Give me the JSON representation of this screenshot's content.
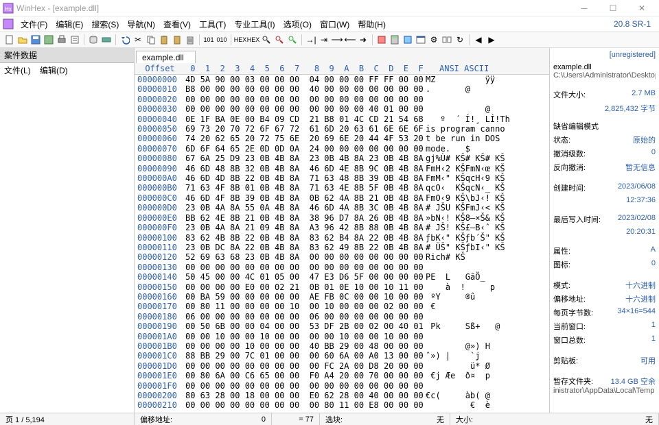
{
  "title": "WinHex - [example.dll]",
  "version": "20.8 SR-1",
  "menubar": [
    "文件(F)",
    "编辑(E)",
    "搜索(S)",
    "导航(N)",
    "查看(V)",
    "工具(T)",
    "专业工具(I)",
    "选项(O)",
    "窗口(W)",
    "帮助(H)"
  ],
  "left_panel": {
    "header": "案件数据",
    "menu": [
      "文件(L)",
      "编辑(D)"
    ]
  },
  "tab": "example.dll",
  "hex_head": {
    "offset": "Offset",
    "cols": " 0  1  2  3  4  5  6  7   8  9  A  B  C  D  E  F",
    "ascii": "ANSI ASCII"
  },
  "rows": [
    {
      "addr": "00000000",
      "b": "4D 5A 90 00 03 00 00 00  04 00 00 00 FF FF 00 00",
      "a": "MZ          ÿÿ"
    },
    {
      "addr": "00000010",
      "b": "B8 00 00 00 00 00 00 00  40 00 00 00 00 00 00 00",
      "a": ".       @"
    },
    {
      "addr": "00000020",
      "b": "00 00 00 00 00 00 00 00  00 00 00 00 00 00 00 00",
      "a": ""
    },
    {
      "addr": "00000030",
      "b": "00 00 00 00 00 00 00 00  00 00 00 00 40 01 00 00",
      "a": "            @"
    },
    {
      "addr": "00000040",
      "b": "0E 1F BA 0E 00 B4 09 CD  21 B8 01 4C CD 21 54 68",
      "a": "   º  ´ Í!¸ LÍ!Th"
    },
    {
      "addr": "00000050",
      "b": "69 73 20 70 72 6F 67 72  61 6D 20 63 61 6E 6E 6F",
      "a": "is program canno"
    },
    {
      "addr": "00000060",
      "b": "74 20 62 65 20 72 75 6E  20 69 6E 20 44 4F 53 20",
      "a": "t be run in DOS "
    },
    {
      "addr": "00000070",
      "b": "6D 6F 64 65 2E 0D 0D 0A  24 00 00 00 00 00 00 00",
      "a": "mode.   $"
    },
    {
      "addr": "00000080",
      "b": "67 6A 25 D9 23 0B 4B 8A  23 0B 4B 8A 23 0B 4B 8A",
      "a": "gj%Ù# KŠ# KŠ# KŠ"
    },
    {
      "addr": "00000090",
      "b": "46 6D 48 8B 32 0B 4B 8A  46 6D 4E 8B 9C 0B 4B 8A",
      "a": "FmH‹2 KŠFmN‹œ KŠ"
    },
    {
      "addr": "000000A0",
      "b": "46 6D 4D 8B 22 0B 4B 8A  71 63 48 8B 39 0B 4B 8A",
      "a": "FmM‹\" KŠqcH‹9 KŠ"
    },
    {
      "addr": "000000B0",
      "b": "71 63 4F 8B 01 0B 4B 8A  71 63 4E 8B 5F 0B 4B 8A",
      "a": "qcO‹  KŠqcN‹_ KŠ"
    },
    {
      "addr": "000000C0",
      "b": "46 6D 4F 8B 39 0B 4B 8A  0B 62 4A 8B 21 0B 4B 8A",
      "a": "FmO‹9 KŠ\\bJ‹! KŠ"
    },
    {
      "addr": "000000D0",
      "b": "23 0B 4A 8A 55 0A 4B 8A  46 6D 4A 8B 3C 0B 4B 8A",
      "a": "# JŠU KŠFmJ‹< KŠ"
    },
    {
      "addr": "000000E0",
      "b": "BB 62 4E 8B 21 0B 4B 8A  38 96 D7 8A 26 0B 4B 8A",
      "a": "»bN‹! KŠ8–×Š& KŠ"
    },
    {
      "addr": "000000F0",
      "b": "23 0B 4A 8A 21 09 4B 8A  A3 96 42 8B 88 0B 4B 8A",
      "a": "# JŠ! KŠ£–B‹ˆ KŠ"
    },
    {
      "addr": "00000100",
      "b": "83 62 4B 8B 22 0B 4B 8A  83 62 B4 8A 22 0B 4B 8A",
      "a": "ƒbK‹\" KŠƒb´Š\" KŠ"
    },
    {
      "addr": "00000110",
      "b": "23 0B DC 8A 22 0B 4B 8A  83 62 49 8B 22 0B 4B 8A",
      "a": "# ÜŠ\" KŠƒbI‹\" KŠ"
    },
    {
      "addr": "00000120",
      "b": "52 69 63 68 23 0B 4B 8A  00 00 00 00 00 00 00 00",
      "a": "Rich# KŠ"
    },
    {
      "addr": "00000130",
      "b": "00 00 00 00 00 00 00 00  00 00 00 00 00 00 00 00",
      "a": ""
    },
    {
      "addr": "00000140",
      "b": "50 45 00 00 4C 01 05 00  47 E3 D6 5F 00 00 00 00",
      "a": "PE  L   GãÖ_"
    },
    {
      "addr": "00000150",
      "b": "00 00 00 00 E0 00 02 21  0B 01 0E 10 00 10 11 00",
      "a": "    à  !     p"
    },
    {
      "addr": "00000160",
      "b": "00 BA 59 00 00 00 00 00  AE FB 0C 00 00 10 00 00",
      "a": " ºY     ®û"
    },
    {
      "addr": "00000170",
      "b": "00 80 11 00 00 00 00 10  00 10 00 00 00 02 00 00",
      "a": " €"
    },
    {
      "addr": "00000180",
      "b": "06 00 00 00 00 00 00 00  06 00 00 00 00 00 00 00",
      "a": ""
    },
    {
      "addr": "00000190",
      "b": "00 50 6B 00 00 04 00 00  53 DF 2B 00 02 00 40 01",
      "a": " Pk     Sß+   @"
    },
    {
      "addr": "000001A0",
      "b": "00 00 10 00 00 10 00 00  00 00 10 00 00 10 00 00",
      "a": ""
    },
    {
      "addr": "000001B0",
      "b": "00 00 00 00 10 00 00 00  40 BB 29 00 48 00 00 00",
      "a": "        @») H"
    },
    {
      "addr": "000001C0",
      "b": "88 BB 29 00 7C 01 00 00  00 60 6A 00 A0 13 00 00",
      "a": "ˆ») |    `j  "
    },
    {
      "addr": "000001D0",
      "b": "00 00 00 00 00 00 00 00  00 FC 2A 00 D8 20 00 00",
      "a": "         ü* Ø"
    },
    {
      "addr": "000001E0",
      "b": "00 80 6A 00 C6 65 00 00  F0 A4 20 00 70 00 00 00",
      "a": " €j Æe  ð¤  p"
    },
    {
      "addr": "000001F0",
      "b": "00 00 00 00 00 00 00 00  00 00 00 00 00 00 00 00",
      "a": ""
    },
    {
      "addr": "00000200",
      "b": "80 63 28 00 18 00 00 00  E0 62 28 00 40 00 00 00",
      "a": "€c(     àb( @"
    },
    {
      "addr": "00000210",
      "b": "00 00 00 00 00 00 00 00  00 80 11 00 E8 00 00 00",
      "a": "         €  è"
    }
  ],
  "right": {
    "unregistered": "[unregistered]",
    "filename": "example.dll",
    "filepath": "C:\\Users\\Administrator\\Desktop",
    "filesize_label": "文件大小:",
    "filesize": "2.7 MB",
    "filesize_bytes": "2,825,432 字节",
    "edit_mode_header": "缺省编辑模式",
    "state_label": "状态:",
    "state": "原始的",
    "undo_label": "撤消级数:",
    "undo": "0",
    "reverse_label": "反向撤消:",
    "reverse": "暂无信息",
    "created_label": "创建时间:",
    "created_date": "2023/06/08",
    "created_time": "12:37:36",
    "modified_label": "最后写入时间:",
    "modified_date": "2023/02/08",
    "modified_time": "20:20:31",
    "attr_label": "属性:",
    "attr": "A",
    "icons_label": "图标:",
    "icons": "0",
    "mode_label": "模式:",
    "mode": "十六进制",
    "offset_mode_label": "偏移地址:",
    "offset_mode": "十六进制",
    "bpr_label": "每页字节数:",
    "bpr": "34×16=544",
    "curwin_label": "当前窗口:",
    "curwin": "1",
    "totwin_label": "窗口总数:",
    "totwin": "1",
    "clipboard_label": "剪贴板:",
    "clipboard": "可用",
    "temp_label": "暂存文件夹:",
    "temp": "13.4 GB 空余",
    "temp_path": "inistrator\\AppData\\Local\\Temp"
  },
  "statusbar": {
    "page": "页 1 / 5,194",
    "offset_label": "偏移地址:",
    "offset_val": "0",
    "eq": "= 77",
    "sel_label": "选块:",
    "sel_val": "无",
    "size_label": "大小:",
    "size_val": "无"
  }
}
